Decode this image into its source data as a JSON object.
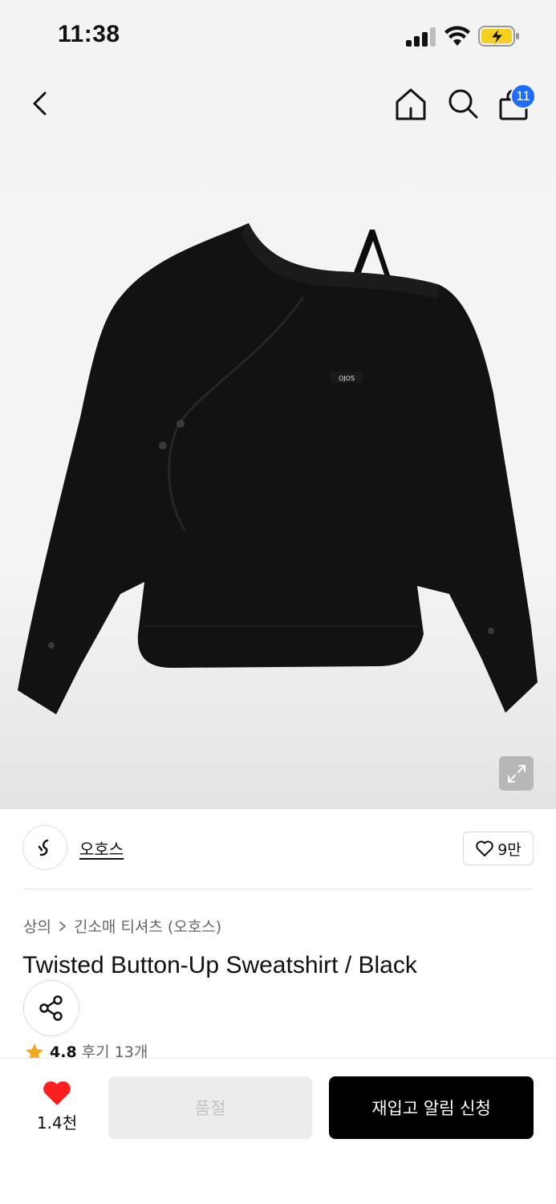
{
  "status_bar": {
    "time": "11:38"
  },
  "nav": {
    "cart_count": "11"
  },
  "product_image": {
    "shirt_print": "OJOS"
  },
  "brand": {
    "name": "오호스",
    "like_count": "9만"
  },
  "breadcrumb": {
    "category": "상의",
    "subcategory": "긴소매 티셔츠 (오호스)"
  },
  "product": {
    "title": "Twisted Button-Up Sweatshirt / Black"
  },
  "rating": {
    "value": "4.8",
    "reviews": "후기 13개"
  },
  "bottom_bar": {
    "wish_count": "1.4천",
    "soldout_label": "품절",
    "restock_label": "재입고 알림 신청"
  },
  "colors": {
    "accent_blue": "#1e6bff",
    "heart_red": "#ff1f1f",
    "star_orange": "#f5a623",
    "cta_black": "#000000"
  }
}
